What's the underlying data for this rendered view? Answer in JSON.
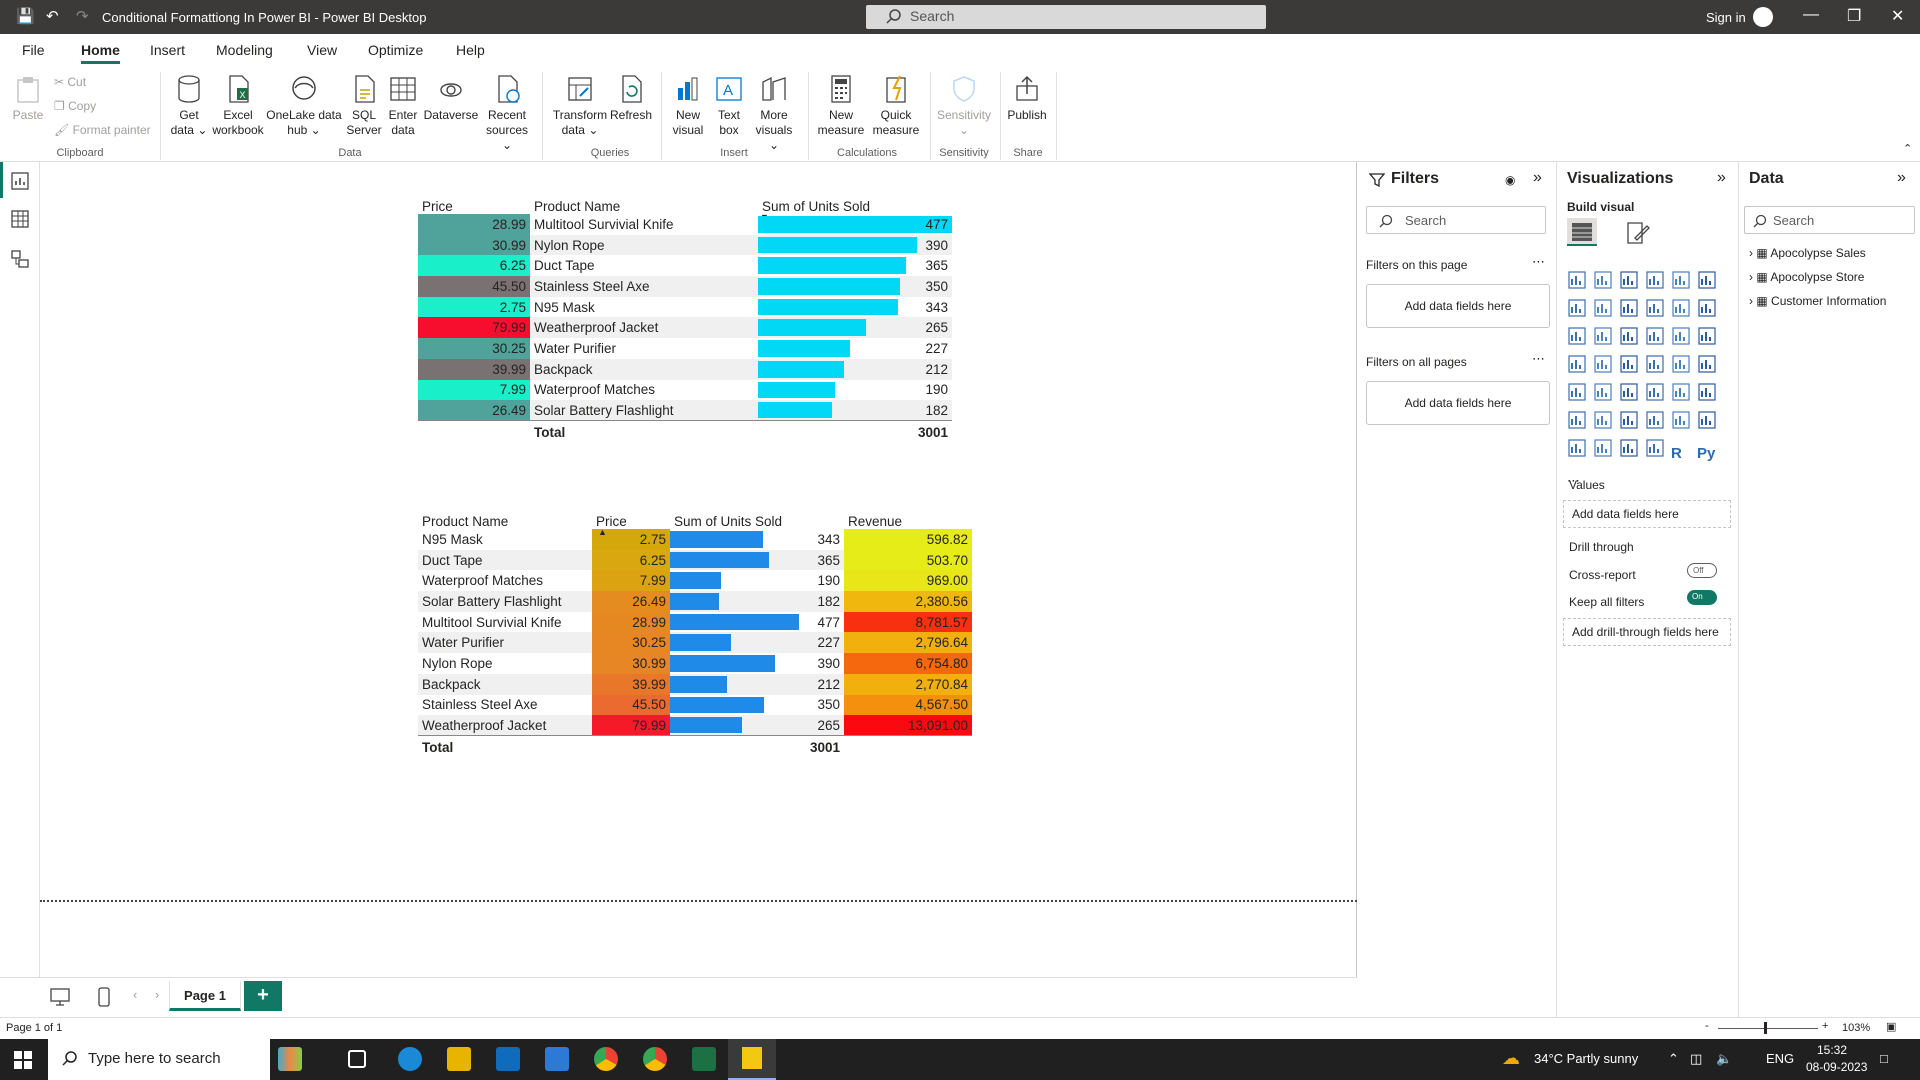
{
  "titlebar": {
    "title": "Conditional Formattiong In Power BI - Power BI Desktop",
    "search_placeholder": "Search",
    "signin": "Sign in"
  },
  "menu": [
    "File",
    "Home",
    "Insert",
    "Modeling",
    "View",
    "Optimize",
    "Help"
  ],
  "ribbon": {
    "clipboard": {
      "paste": "Paste",
      "cut": "Cut",
      "copy": "Copy",
      "format_painter": "Format painter",
      "group": "Clipboard"
    },
    "data": {
      "get_data": "Get data",
      "excel": "Excel workbook",
      "onelake": "OneLake data hub",
      "sql": "SQL Server",
      "enter_data": "Enter data",
      "dataverse": "Dataverse",
      "recent": "Recent sources",
      "group": "Data"
    },
    "queries": {
      "transform": "Transform data",
      "refresh": "Refresh",
      "group": "Queries"
    },
    "insert": {
      "new_visual": "New visual",
      "text_box": "Text box",
      "more_visuals": "More visuals",
      "group": "Insert"
    },
    "calculations": {
      "new_measure": "New measure",
      "quick_measure": "Quick measure",
      "group": "Calculations"
    },
    "sensitivity": {
      "sensitivity": "Sensitivity",
      "group": "Sensitivity"
    },
    "share": {
      "publish": "Publish",
      "group": "Share"
    }
  },
  "table1": {
    "headers": [
      "Price",
      "Product Name",
      "Sum of Units Sold"
    ],
    "rows": [
      {
        "price": "28.99",
        "name": "Multitool Survivial Knife",
        "units": "477",
        "units_val": 477,
        "price_color": "#4fa39a"
      },
      {
        "price": "30.99",
        "name": "Nylon Rope",
        "units": "390",
        "units_val": 390,
        "price_color": "#4fa39a"
      },
      {
        "price": "6.25",
        "name": "Duct Tape",
        "units": "365",
        "units_val": 365,
        "price_color": "#19f0c9"
      },
      {
        "price": "45.50",
        "name": "Stainless Steel Axe",
        "units": "350",
        "units_val": 350,
        "price_color": "#7a7272"
      },
      {
        "price": "2.75",
        "name": "N95 Mask",
        "units": "343",
        "units_val": 343,
        "price_color": "#19f0c9"
      },
      {
        "price": "79.99",
        "name": "Weatherproof Jacket",
        "units": "265",
        "units_val": 265,
        "price_color": "#f70e2f"
      },
      {
        "price": "30.25",
        "name": "Water Purifier",
        "units": "227",
        "units_val": 227,
        "price_color": "#4fa39a"
      },
      {
        "price": "39.99",
        "name": "Backpack",
        "units": "212",
        "units_val": 212,
        "price_color": "#7a7272"
      },
      {
        "price": "7.99",
        "name": "Waterproof Matches",
        "units": "190",
        "units_val": 190,
        "price_color": "#19f0c9"
      },
      {
        "price": "26.49",
        "name": "Solar Battery Flashlight",
        "units": "182",
        "units_val": 182,
        "price_color": "#4fa39a"
      }
    ],
    "total_label": "Total",
    "total_units": "3001",
    "bar_color": "#00d8f5"
  },
  "table2": {
    "headers": [
      "Product Name",
      "Price",
      "Sum of Units Sold",
      "Revenue"
    ],
    "rows": [
      {
        "name": "N95 Mask",
        "price": "2.75",
        "units": "343",
        "units_val": 343,
        "revenue": "596.82",
        "price_color": "#d4a80a",
        "rev_color": "#e6ec18"
      },
      {
        "name": "Duct Tape",
        "price": "6.25",
        "units": "365",
        "units_val": 365,
        "revenue": "503.70",
        "price_color": "#d9a70f",
        "rev_color": "#e6ec18"
      },
      {
        "name": "Waterproof Matches",
        "price": "7.99",
        "units": "190",
        "units_val": 190,
        "revenue": "969.00",
        "price_color": "#dba312",
        "rev_color": "#e8e518"
      },
      {
        "name": "Solar Battery Flashlight",
        "price": "26.49",
        "units": "182",
        "units_val": 182,
        "revenue": "2,380.56",
        "price_color": "#e48c20",
        "rev_color": "#f0b70f"
      },
      {
        "name": "Multitool Survivial Knife",
        "price": "28.99",
        "units": "477",
        "units_val": 477,
        "revenue": "8,781.57",
        "price_color": "#e58822",
        "rev_color": "#f8300f"
      },
      {
        "name": "Water Purifier",
        "price": "30.25",
        "units": "227",
        "units_val": 227,
        "revenue": "2,796.64",
        "price_color": "#e68724",
        "rev_color": "#f2b00e"
      },
      {
        "name": "Nylon Rope",
        "price": "30.99",
        "units": "390",
        "units_val": 390,
        "revenue": "6,754.80",
        "price_color": "#e68624",
        "rev_color": "#f6680e"
      },
      {
        "name": "Backpack",
        "price": "39.99",
        "units": "212",
        "units_val": 212,
        "revenue": "2,770.84",
        "price_color": "#e8772a",
        "rev_color": "#f2b00e"
      },
      {
        "name": "Stainless Steel Axe",
        "price": "45.50",
        "units": "350",
        "units_val": 350,
        "revenue": "4,567.50",
        "price_color": "#ea6a2f",
        "rev_color": "#f4900e"
      },
      {
        "name": "Weatherproof Jacket",
        "price": "79.99",
        "units": "265",
        "units_val": 265,
        "revenue": "13,091.00",
        "price_color": "#f41a2a",
        "rev_color": "#fa0a10"
      }
    ],
    "total_label": "Total",
    "total_units": "3001",
    "bar_color": "#1f8ae8"
  },
  "filters": {
    "title": "Filters",
    "search": "Search",
    "on_page": "Filters on this page",
    "all_pages": "Filters on all pages",
    "add": "Add data fields here"
  },
  "viz": {
    "title": "Visualizations",
    "build": "Build visual",
    "values": "Values",
    "add_values": "Add data fields here",
    "drill": "Drill through",
    "cross": "Cross-report",
    "cross_state": "Off",
    "keep": "Keep all filters",
    "keep_state": "On",
    "add_drill": "Add drill-through fields here"
  },
  "data_pane": {
    "title": "Data",
    "search": "Search",
    "tables": [
      "Apocolypse Sales",
      "Apocolypse Store",
      "Customer Information"
    ]
  },
  "pages": {
    "tab": "Page 1",
    "status": "Page 1 of 1",
    "zoom": "103%"
  },
  "taskbar": {
    "search": "Type here to search",
    "weather": "34°C  Partly sunny",
    "lang": "ENG",
    "time": "15:32",
    "date": "08-09-2023"
  }
}
